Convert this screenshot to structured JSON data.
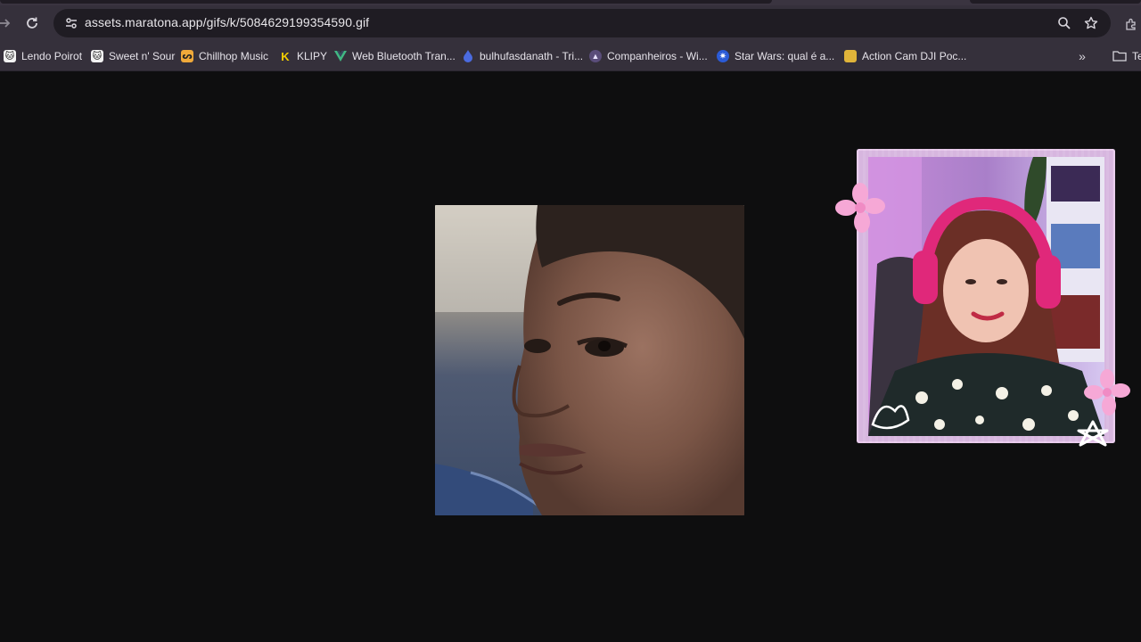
{
  "browser": {
    "url": "assets.maratona.app/gifs/k/5084629199354590.gif",
    "icons": {
      "forward": "arrow-right-icon",
      "reload": "reload-icon",
      "site_info": "tune-icon",
      "zoom": "zoom-icon",
      "bookmark": "star-icon",
      "extensions": "puzzle-icon"
    }
  },
  "bookmarks": {
    "items": [
      {
        "label": "Lendo Poirot",
        "icon": "cat-icon"
      },
      {
        "label": "Sweet n' Sour",
        "icon": "cat-icon"
      },
      {
        "label": "Chillhop Music",
        "icon": "chillhop-icon"
      },
      {
        "label": "KLIPY",
        "icon": "klipy-icon"
      },
      {
        "label": "Web Bluetooth Tran...",
        "icon": "vue-icon"
      },
      {
        "label": "bulhufasdanath - Tri...",
        "icon": "droplet-icon"
      },
      {
        "label": "Companheiros - Wi...",
        "icon": "wiki-icon"
      },
      {
        "label": "Star Wars: qual é a...",
        "icon": "gear-icon"
      },
      {
        "label": "Action Cam DJI Poc...",
        "icon": "folder-yellow-icon"
      }
    ],
    "folder_label": "Te"
  }
}
